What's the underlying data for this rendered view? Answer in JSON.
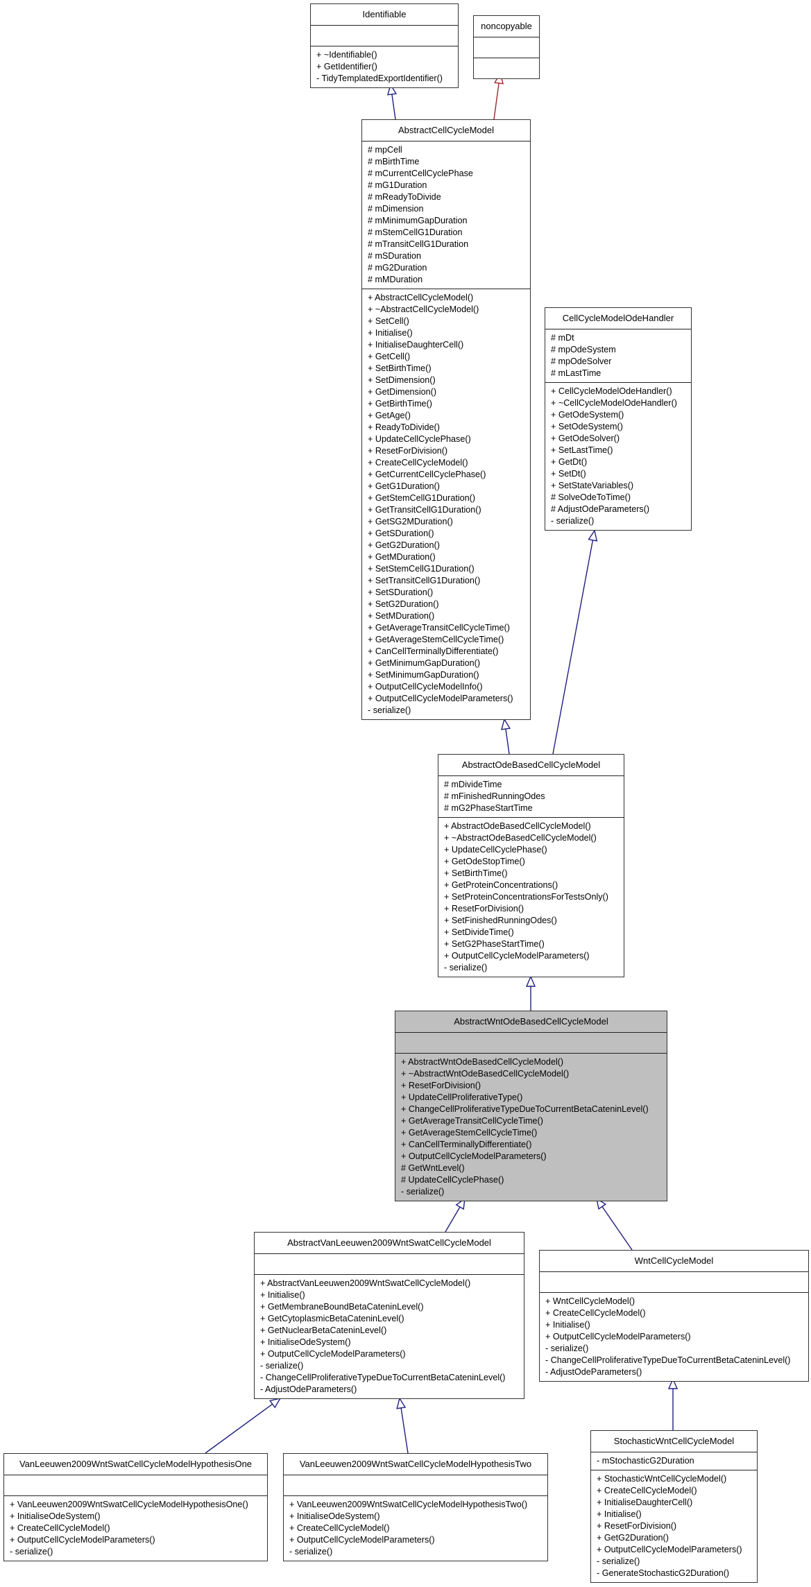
{
  "diagram": {
    "type": "class-inheritance",
    "focus_class": "AbstractWntOdeBasedCellCycleModel",
    "colors": {
      "edge_public": "#1f1f80",
      "edge_private": "#9a2a2a",
      "focus_fill": "#bfbfbf",
      "box_fill": "#ffffff"
    },
    "classes": {
      "identifiable": {
        "name": "Identifiable",
        "attributes": [],
        "methods": [
          "+ ~Identifiable()",
          "+ GetIdentifier()",
          "- TidyTemplatedExportIdentifier()"
        ]
      },
      "noncopyable": {
        "name": "noncopyable",
        "attributes": [],
        "methods": []
      },
      "abstract_cell_cycle_model": {
        "name": "AbstractCellCycleModel",
        "attributes": [
          "# mpCell",
          "# mBirthTime",
          "# mCurrentCellCyclePhase",
          "# mG1Duration",
          "# mReadyToDivide",
          "# mDimension",
          "# mMinimumGapDuration",
          "# mStemCellG1Duration",
          "# mTransitCellG1Duration",
          "# mSDuration",
          "# mG2Duration",
          "# mMDuration"
        ],
        "methods": [
          "+ AbstractCellCycleModel()",
          "+ ~AbstractCellCycleModel()",
          "+ SetCell()",
          "+ Initialise()",
          "+ InitialiseDaughterCell()",
          "+ GetCell()",
          "+ SetBirthTime()",
          "+ SetDimension()",
          "+ GetDimension()",
          "+ GetBirthTime()",
          "+ GetAge()",
          "+ ReadyToDivide()",
          "+ UpdateCellCyclePhase()",
          "+ ResetForDivision()",
          "+ CreateCellCycleModel()",
          "+ GetCurrentCellCyclePhase()",
          "+ GetG1Duration()",
          "+ GetStemCellG1Duration()",
          "+ GetTransitCellG1Duration()",
          "+ GetSG2MDuration()",
          "+ GetSDuration()",
          "+ GetG2Duration()",
          "+ GetMDuration()",
          "+ SetStemCellG1Duration()",
          "+ SetTransitCellG1Duration()",
          "+ SetSDuration()",
          "+ SetG2Duration()",
          "+ SetMDuration()",
          "+ GetAverageTransitCellCycleTime()",
          "+ GetAverageStemCellCycleTime()",
          "+ CanCellTerminallyDifferentiate()",
          "+ GetMinimumGapDuration()",
          "+ SetMinimumGapDuration()",
          "+ OutputCellCycleModelInfo()",
          "+ OutputCellCycleModelParameters()",
          "- serialize()"
        ]
      },
      "cell_cycle_model_ode_handler": {
        "name": "CellCycleModelOdeHandler",
        "attributes": [
          "# mDt",
          "# mpOdeSystem",
          "# mpOdeSolver",
          "# mLastTime"
        ],
        "methods": [
          "+ CellCycleModelOdeHandler()",
          "+ ~CellCycleModelOdeHandler()",
          "+ GetOdeSystem()",
          "+ SetOdeSystem()",
          "+ GetOdeSolver()",
          "+ SetLastTime()",
          "+ GetDt()",
          "+ SetDt()",
          "+ SetStateVariables()",
          "# SolveOdeToTime()",
          "# AdjustOdeParameters()",
          "- serialize()"
        ]
      },
      "abstract_ode_based_cell_cycle_model": {
        "name": "AbstractOdeBasedCellCycleModel",
        "attributes": [
          "# mDivideTime",
          "# mFinishedRunningOdes",
          "# mG2PhaseStartTime"
        ],
        "methods": [
          "+ AbstractOdeBasedCellCycleModel()",
          "+ ~AbstractOdeBasedCellCycleModel()",
          "+ UpdateCellCyclePhase()",
          "+ GetOdeStopTime()",
          "+ SetBirthTime()",
          "+ GetProteinConcentrations()",
          "+ SetProteinConcentrationsForTestsOnly()",
          "+ ResetForDivision()",
          "+ SetFinishedRunningOdes()",
          "+ SetDivideTime()",
          "+ SetG2PhaseStartTime()",
          "+ OutputCellCycleModelParameters()",
          "- serialize()"
        ]
      },
      "abstract_wnt_ode_based_cell_cycle_model": {
        "name": "AbstractWntOdeBasedCellCycleModel",
        "attributes": [],
        "methods": [
          "+ AbstractWntOdeBasedCellCycleModel()",
          "+ ~AbstractWntOdeBasedCellCycleModel()",
          "+ ResetForDivision()",
          "+ UpdateCellProliferativeType()",
          "+ ChangeCellProliferativeTypeDueToCurrentBetaCateninLevel()",
          "+ GetAverageTransitCellCycleTime()",
          "+ GetAverageStemCellCycleTime()",
          "+ CanCellTerminallyDifferentiate()",
          "+ OutputCellCycleModelParameters()",
          "# GetWntLevel()",
          "# UpdateCellCyclePhase()",
          "- serialize()"
        ]
      },
      "abstract_van_leeuwen_2009": {
        "name": "AbstractVanLeeuwen2009WntSwatCellCycleModel",
        "attributes": [],
        "methods": [
          "+ AbstractVanLeeuwen2009WntSwatCellCycleModel()",
          "+ Initialise()",
          "+ GetMembraneBoundBetaCateninLevel()",
          "+ GetCytoplasmicBetaCateninLevel()",
          "+ GetNuclearBetaCateninLevel()",
          "+ InitialiseOdeSystem()",
          "+ OutputCellCycleModelParameters()",
          "- serialize()",
          "- ChangeCellProliferativeTypeDueToCurrentBetaCateninLevel()",
          "- AdjustOdeParameters()"
        ]
      },
      "wnt_cell_cycle_model": {
        "name": "WntCellCycleModel",
        "attributes": [],
        "methods": [
          "+ WntCellCycleModel()",
          "+ CreateCellCycleModel()",
          "+ Initialise()",
          "+ OutputCellCycleModelParameters()",
          "- serialize()",
          "- ChangeCellProliferativeTypeDueToCurrentBetaCateninLevel()",
          "- AdjustOdeParameters()"
        ]
      },
      "hypothesis_one": {
        "name": "VanLeeuwen2009WntSwatCellCycleModelHypothesisOne",
        "attributes": [],
        "methods": [
          "+ VanLeeuwen2009WntSwatCellCycleModelHypothesisOne()",
          "+ InitialiseOdeSystem()",
          "+ CreateCellCycleModel()",
          "+ OutputCellCycleModelParameters()",
          "- serialize()"
        ]
      },
      "hypothesis_two": {
        "name": "VanLeeuwen2009WntSwatCellCycleModelHypothesisTwo",
        "attributes": [],
        "methods": [
          "+ VanLeeuwen2009WntSwatCellCycleModelHypothesisTwo()",
          "+ InitialiseOdeSystem()",
          "+ CreateCellCycleModel()",
          "+ OutputCellCycleModelParameters()",
          "- serialize()"
        ]
      },
      "stochastic_wnt_cell_cycle_model": {
        "name": "StochasticWntCellCycleModel",
        "attributes": [
          "- mStochasticG2Duration"
        ],
        "methods": [
          "+ StochasticWntCellCycleModel()",
          "+ CreateCellCycleModel()",
          "+ InitialiseDaughterCell()",
          "+ Initialise()",
          "+ ResetForDivision()",
          "+ GetG2Duration()",
          "+ OutputCellCycleModelParameters()",
          "- serialize()",
          "- GenerateStochasticG2Duration()"
        ]
      }
    },
    "inheritance": [
      {
        "child": "abstract_cell_cycle_model",
        "parent": "identifiable",
        "kind": "public"
      },
      {
        "child": "abstract_cell_cycle_model",
        "parent": "noncopyable",
        "kind": "private"
      },
      {
        "child": "abstract_ode_based_cell_cycle_model",
        "parent": "abstract_cell_cycle_model",
        "kind": "public"
      },
      {
        "child": "abstract_ode_based_cell_cycle_model",
        "parent": "cell_cycle_model_ode_handler",
        "kind": "public"
      },
      {
        "child": "abstract_wnt_ode_based_cell_cycle_model",
        "parent": "abstract_ode_based_cell_cycle_model",
        "kind": "public"
      },
      {
        "child": "abstract_van_leeuwen_2009",
        "parent": "abstract_wnt_ode_based_cell_cycle_model",
        "kind": "public"
      },
      {
        "child": "wnt_cell_cycle_model",
        "parent": "abstract_wnt_ode_based_cell_cycle_model",
        "kind": "public"
      },
      {
        "child": "hypothesis_one",
        "parent": "abstract_van_leeuwen_2009",
        "kind": "public"
      },
      {
        "child": "hypothesis_two",
        "parent": "abstract_van_leeuwen_2009",
        "kind": "public"
      },
      {
        "child": "stochastic_wnt_cell_cycle_model",
        "parent": "wnt_cell_cycle_model",
        "kind": "public"
      }
    ]
  }
}
